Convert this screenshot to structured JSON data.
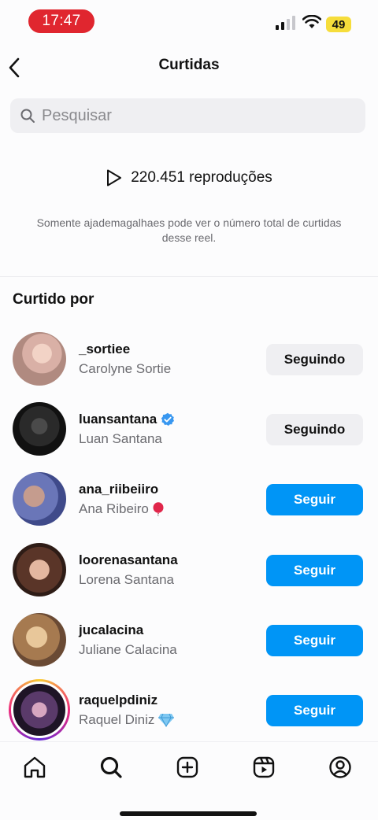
{
  "status_bar": {
    "time": "17:47",
    "battery": "49"
  },
  "header": {
    "title": "Curtidas"
  },
  "search": {
    "placeholder": "Pesquisar"
  },
  "plays": {
    "text": "220.451 reproduções"
  },
  "privacy_note": "Somente ajademagalhaes pode ver o número total de curtidas desse reel.",
  "section_title": "Curtido por",
  "users": [
    {
      "username": "_sortiee",
      "fullname": "Carolyne Sortie",
      "button": "Seguindo",
      "verified": false,
      "avatar_color": "#d9b0a6"
    },
    {
      "username": "luansantana",
      "fullname": "Luan Santana",
      "button": "Seguindo",
      "verified": true,
      "avatar_color": "#1a1a1a"
    },
    {
      "username": "ana_riibeiiro",
      "fullname": "Ana Ribeiro",
      "button": "Seguir",
      "verified": false,
      "avatar_color": "#6a76b8"
    },
    {
      "username": "loorenasantana",
      "fullname": "Lorena Santana",
      "button": "Seguir",
      "verified": false,
      "avatar_color": "#8d5a4a"
    },
    {
      "username": "jucalacina",
      "fullname": "Juliane Calacina",
      "button": "Seguir",
      "verified": false,
      "avatar_color": "#c89a6a"
    },
    {
      "username": "raquelpdiniz",
      "fullname": "Raquel Diniz",
      "button": "Seguir",
      "verified": false,
      "avatar_color": "#5a3a6a"
    }
  ],
  "colors": {
    "follow_blue": "#0095f6",
    "verified_blue": "#3897f0",
    "status_red": "#e0262f",
    "battery_yellow": "#f6dd3b"
  },
  "icons": [
    "back-arrow-icon",
    "search-icon",
    "play-icon",
    "verified-icon",
    "balloon-emoji",
    "diamond-emoji",
    "home-icon",
    "explore-search-icon",
    "create-plus-icon",
    "reels-icon",
    "profile-icon"
  ]
}
